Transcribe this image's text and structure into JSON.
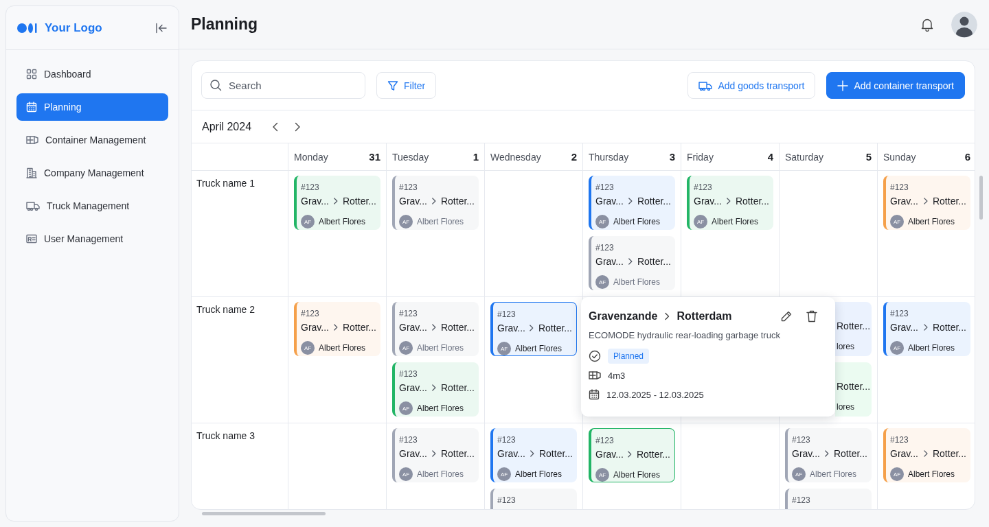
{
  "sidebar": {
    "logo": "Your Logo",
    "items": [
      {
        "label": "Dashboard",
        "selected": false
      },
      {
        "label": "Planning",
        "selected": true
      },
      {
        "label": "Container Management",
        "selected": false
      },
      {
        "label": "Company Management",
        "selected": false
      },
      {
        "label": "Truck Management",
        "selected": false
      },
      {
        "label": "User Management",
        "selected": false
      }
    ]
  },
  "header": {
    "title": "Planning"
  },
  "toolbar": {
    "search": {
      "placeholder": "Search"
    },
    "filter_button": "Filter",
    "goods_button": "Add goods transport",
    "container_button": "Add container transport"
  },
  "calendar": {
    "month": "April 2024",
    "days": [
      {
        "name": "Monday",
        "date": "31"
      },
      {
        "name": "Tuesday",
        "date": "1"
      },
      {
        "name": "Wednesday",
        "date": "2"
      },
      {
        "name": "Thursday",
        "date": "3"
      },
      {
        "name": "Friday",
        "date": "4"
      },
      {
        "name": "Saturday",
        "date": "5"
      },
      {
        "name": "Sunday",
        "date": "6"
      }
    ],
    "rows": [
      {
        "truck": "Truck name 1",
        "cells": [
          [
            {
              "id": "#123",
              "from": "Grav...",
              "to": "Rotter...",
              "initials": "AF",
              "driver": "Albert Flores",
              "color": "#22b566",
              "muted": false,
              "highlighted": false
            }
          ],
          [
            {
              "id": "#123",
              "from": "Grav...",
              "to": "Rotter...",
              "initials": "AF",
              "driver": "Albert Flores",
              "color": "#a0a6b5",
              "muted": true,
              "highlighted": false
            }
          ],
          [],
          [
            {
              "id": "#123",
              "from": "Grav...",
              "to": "Rotter...",
              "initials": "AF",
              "driver": "Albert Flores",
              "color": "#1f76f0",
              "muted": false,
              "highlighted": false
            },
            {
              "id": "#123",
              "from": "Grav...",
              "to": "Rotter...",
              "initials": "AF",
              "driver": "Albert Flores",
              "color": "#a0a6b5",
              "muted": true,
              "highlighted": false
            }
          ],
          [
            {
              "id": "#123",
              "from": "Grav...",
              "to": "Rotter...",
              "initials": "AF",
              "driver": "Albert Flores",
              "color": "#22b566",
              "muted": false,
              "highlighted": false
            }
          ],
          [],
          [
            {
              "id": "#123",
              "from": "Grav...",
              "to": "Rotter...",
              "initials": "AF",
              "driver": "Albert Flores",
              "color": "#f5a04a",
              "muted": false,
              "highlighted": false
            }
          ]
        ]
      },
      {
        "truck": "Truck name 2",
        "cells": [
          [
            {
              "id": "#123",
              "from": "Grav...",
              "to": "Rotter...",
              "initials": "AF",
              "driver": "Albert Flores",
              "color": "#f5a04a",
              "muted": false,
              "highlighted": false
            }
          ],
          [
            {
              "id": "#123",
              "from": "Grav...",
              "to": "Rotter...",
              "initials": "AF",
              "driver": "Albert Flores",
              "color": "#a0a6b5",
              "muted": true,
              "highlighted": false
            },
            {
              "id": "#123",
              "from": "Grav...",
              "to": "Rotter...",
              "initials": "AF",
              "driver": "Albert Flores",
              "color": "#22b566",
              "muted": false,
              "highlighted": false
            }
          ],
          [
            {
              "id": "#123",
              "from": "Grav...",
              "to": "Rotter...",
              "initials": "AF",
              "driver": "Albert Flores",
              "color": "#1f76f0",
              "muted": false,
              "highlighted": true
            }
          ],
          [],
          [],
          [
            {
              "kind": "partial",
              "to": "Rotter...",
              "driver": "lores",
              "color": "#ebf2fe"
            },
            {
              "kind": "partial",
              "to": "Rotter...",
              "driver": "lores",
              "color": "#ebfbf1"
            }
          ],
          [
            {
              "id": "#123",
              "from": "Grav...",
              "to": "Rotter...",
              "initials": "AF",
              "driver": "Albert Flores",
              "color": "#1f76f0",
              "muted": false,
              "highlighted": false
            }
          ]
        ]
      },
      {
        "truck": "Truck name 3",
        "cells": [
          [],
          [
            {
              "id": "#123",
              "from": "Grav...",
              "to": "Rotter...",
              "initials": "AF",
              "driver": "Albert Flores",
              "color": "#a0a6b5",
              "muted": true,
              "highlighted": false
            }
          ],
          [
            {
              "id": "#123",
              "from": "Grav...",
              "to": "Rotter...",
              "initials": "AF",
              "driver": "Albert Flores",
              "color": "#1f76f0",
              "muted": false,
              "highlighted": false
            },
            {
              "id": "#123",
              "color": "#a0a6b5",
              "highlighted": false
            }
          ],
          [
            {
              "id": "#123",
              "from": "Grav...",
              "to": "Rotter...",
              "initials": "AF",
              "driver": "Albert Flores",
              "color": "#22b566",
              "muted": false,
              "highlighted": true
            }
          ],
          [],
          [
            {
              "id": "#123",
              "from": "Grav...",
              "to": "Rotter...",
              "initials": "AF",
              "driver": "Albert Flores",
              "color": "#a0a6b5",
              "muted": true,
              "highlighted": false
            },
            {
              "id": "#123",
              "color": "#a0a6b5",
              "highlighted": false
            }
          ],
          [
            {
              "id": "#123",
              "from": "Grav...",
              "to": "Rotter...",
              "initials": "AF",
              "driver": "Albert Flores",
              "color": "#f5a04a",
              "muted": false,
              "highlighted": false
            }
          ]
        ]
      }
    ]
  },
  "popup": {
    "from": "Gravenzande",
    "to": "Rotterdam",
    "description": "ECOMODE hydraulic rear-loading garbage truck",
    "status": "Planned",
    "volume": "4m3",
    "dates": "12.03.2025 - 12.03.2025"
  }
}
